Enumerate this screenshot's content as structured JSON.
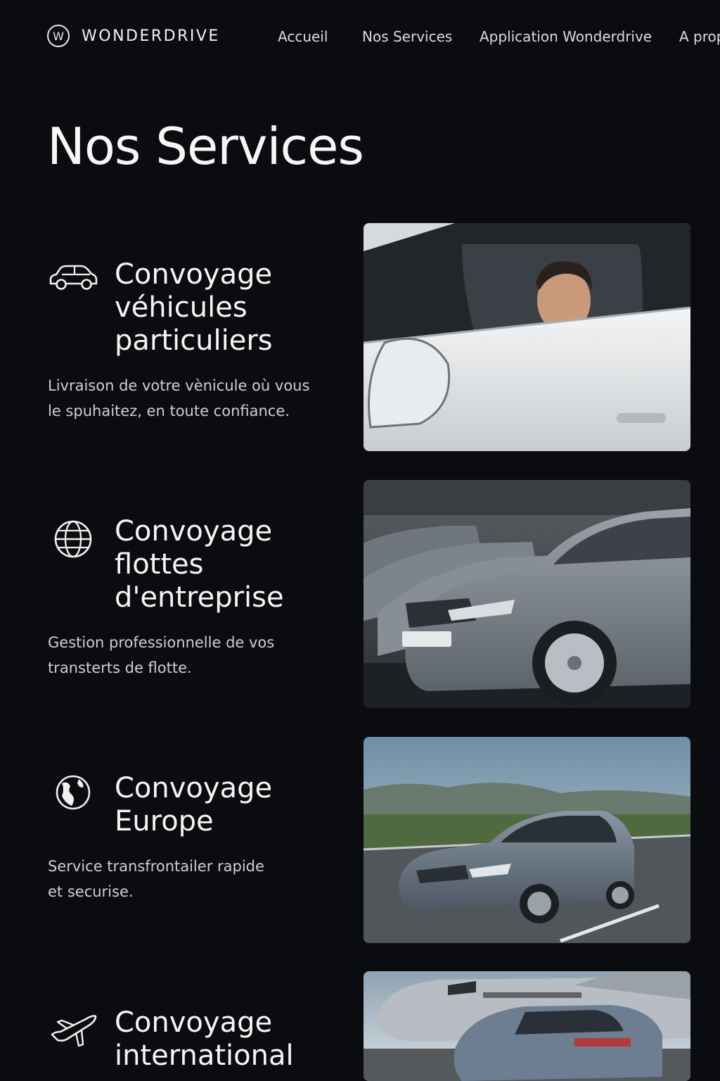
{
  "brand": {
    "logo_letter": "W",
    "name": "WONDERDRIVE"
  },
  "nav": {
    "items": [
      {
        "label": "Accueil"
      },
      {
        "label": "Nos Services"
      },
      {
        "label": "Application Wonderdrive"
      },
      {
        "label": "A prop"
      }
    ]
  },
  "page": {
    "title": "Nos Services"
  },
  "services": [
    {
      "icon": "car-icon",
      "title_lines": [
        "Convoyage",
        "véhicules",
        "particuliers"
      ],
      "desc_lines": [
        "Livraison de votre vènicule où vous",
        "le spuhaitez, en toute confiance."
      ]
    },
    {
      "icon": "globe-icon",
      "title_lines": [
        "Convoyage",
        "flottes",
        "d'entreprise"
      ],
      "desc_lines": [
        "Gestion professionnelle de vos",
        "transterts de flotte."
      ]
    },
    {
      "icon": "earth-icon",
      "title_lines": [
        "Convoyage",
        "Europe"
      ],
      "desc_lines": [
        "Service transfrontailer rapide",
        "et securise."
      ]
    },
    {
      "icon": "airplane-icon",
      "title_lines": [
        "Convoyage",
        "international"
      ],
      "desc_lines": []
    }
  ],
  "colors": {
    "background": "#0b0c0f",
    "text_primary": "#f5f5f5",
    "text_secondary": "#cfcfcf"
  }
}
